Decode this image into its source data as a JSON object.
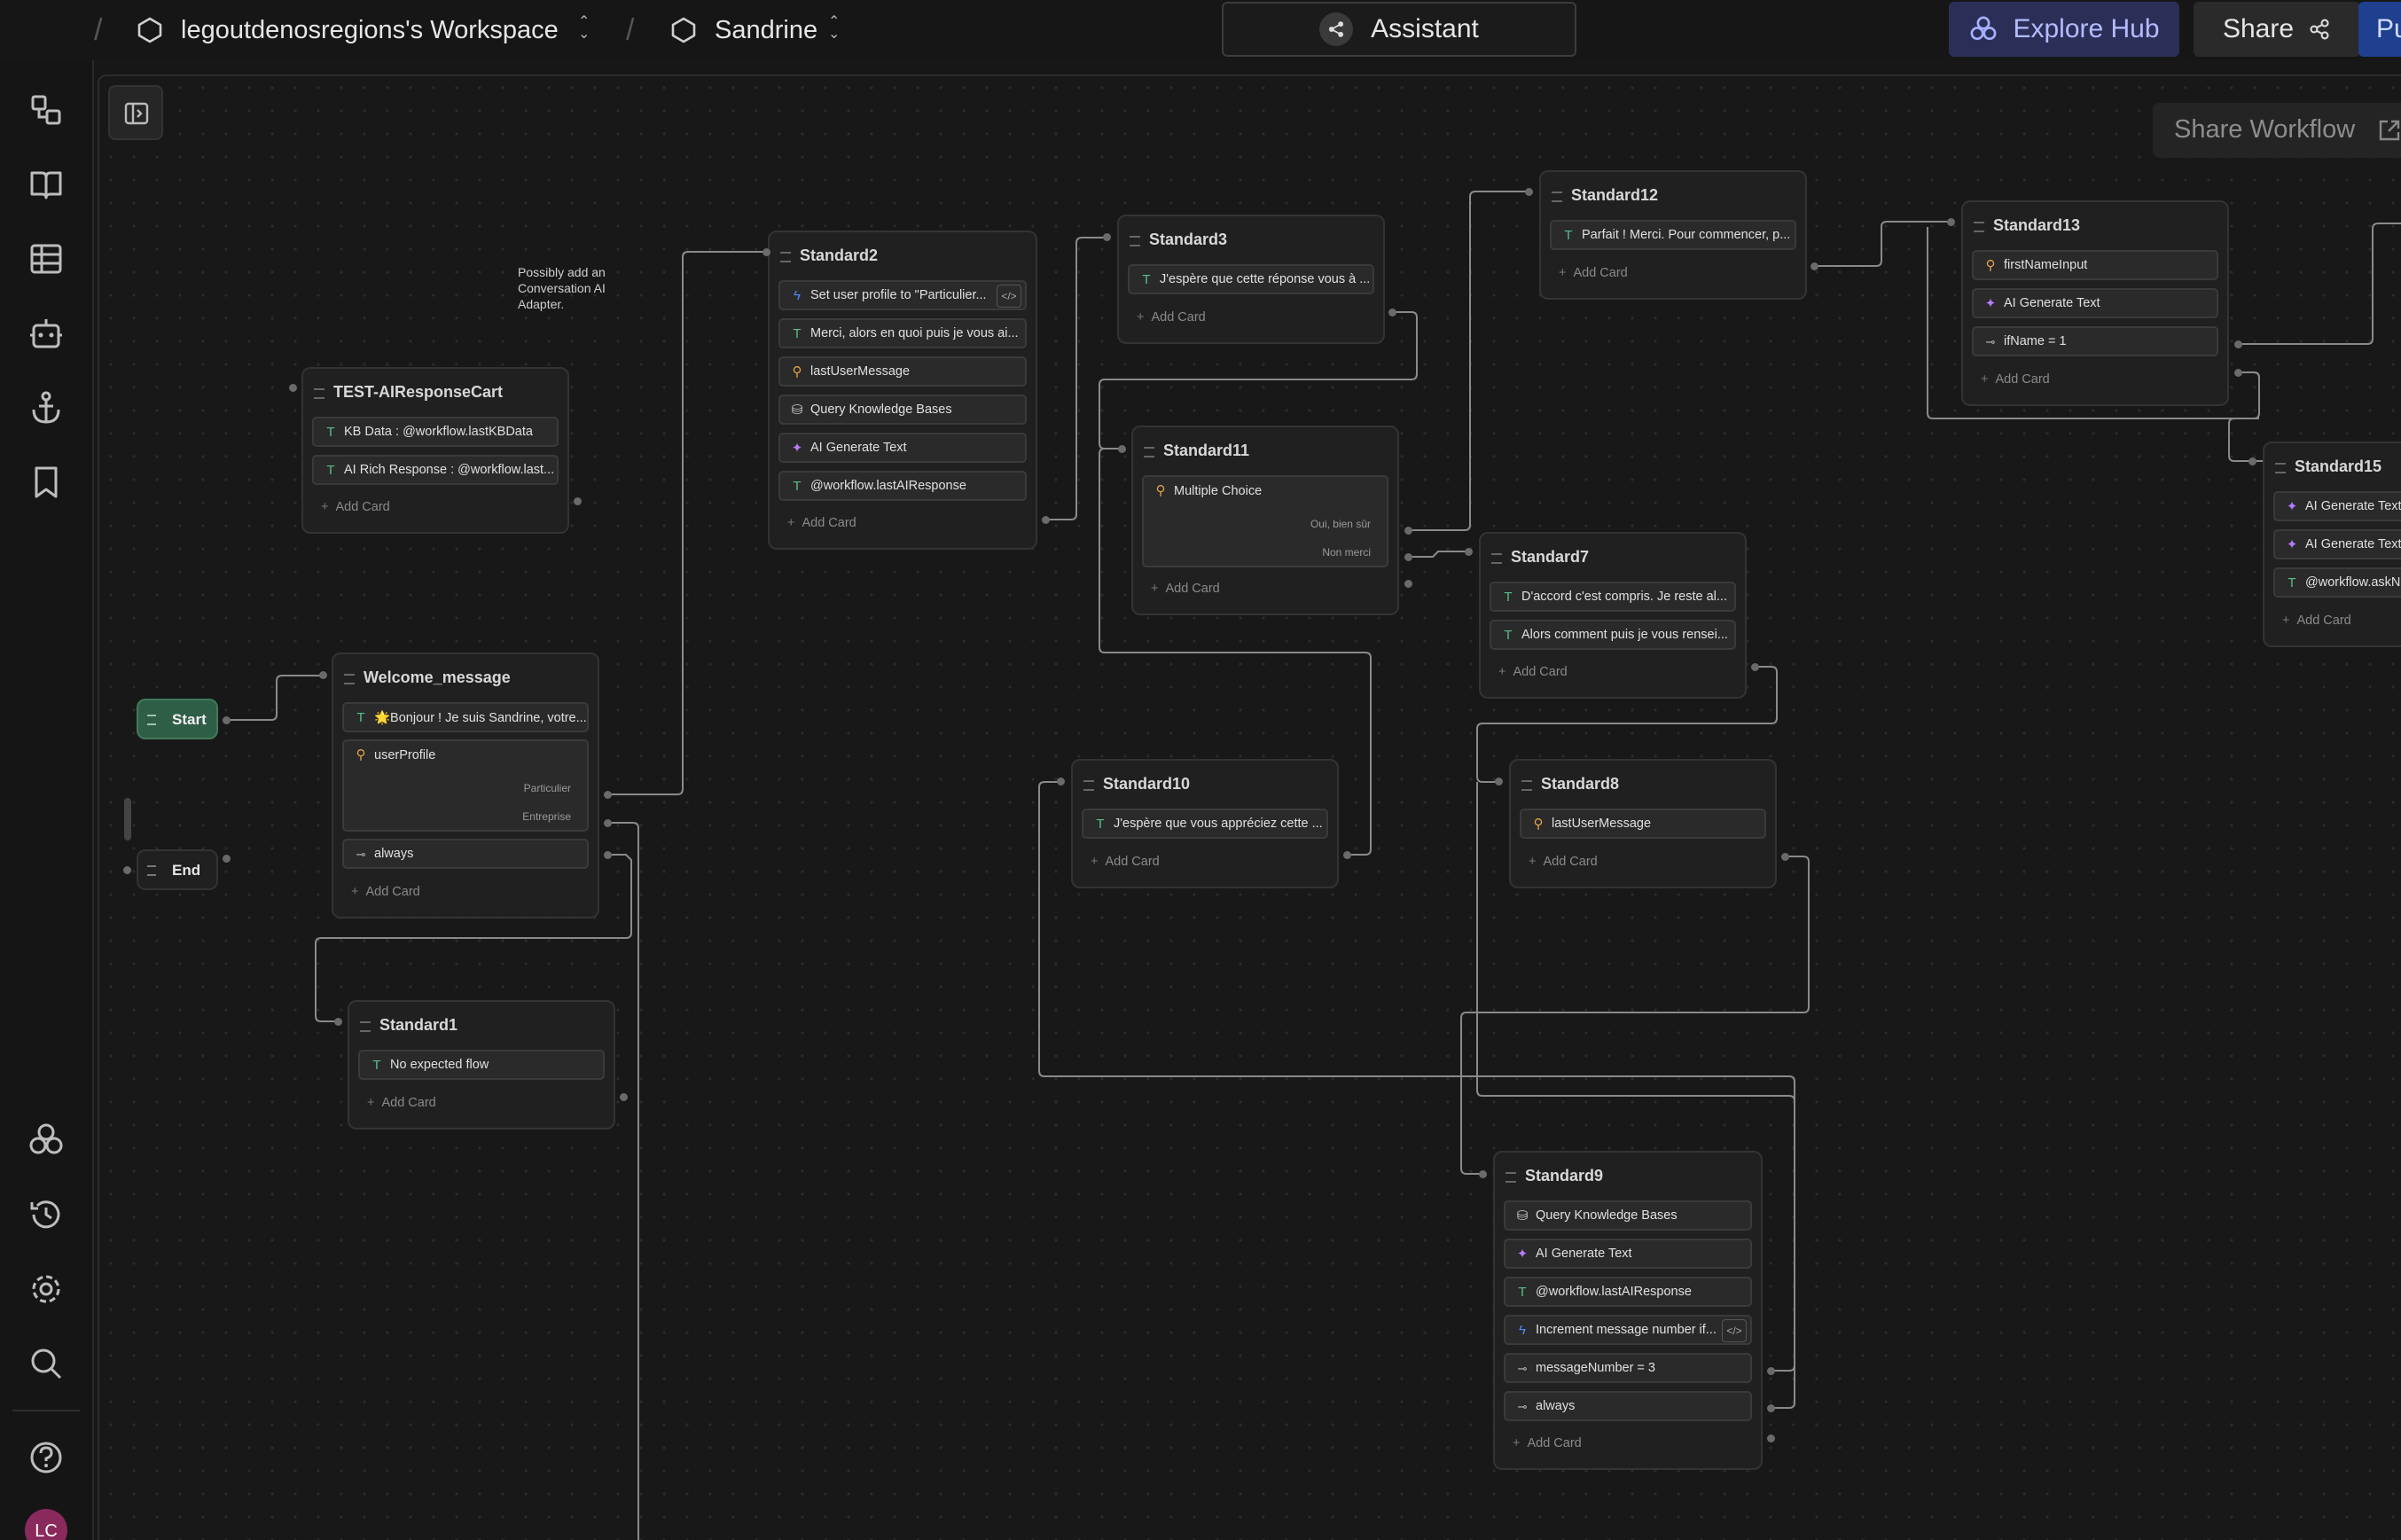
{
  "topbar": {
    "workspace": "legoutdenosregions's Workspace",
    "project": "Sandrine",
    "assistant_label": "Assistant",
    "explore_label": "Explore Hub",
    "share_label": "Share",
    "publish_label": "Pu"
  },
  "canvas": {
    "share_workflow_label": "Share Workflow",
    "note": "Possibly add an Conversation AI Adapter."
  },
  "sidebar": {
    "icons": [
      "flow-icon",
      "book-icon",
      "table-icon",
      "robot-icon",
      "anchor-icon",
      "bookmark-icon",
      "hub-icon",
      "history-icon",
      "settings-icon",
      "search-icon",
      "help-icon"
    ],
    "avatar": "LC"
  },
  "colors": {
    "text_icon": "#55c08a",
    "bolt_icon": "#4c8dff",
    "sparkle_icon": "#b57bff",
    "input_icon": "#e3a34a",
    "start": "#2f5e46"
  },
  "nodes": {
    "start": "Start",
    "end": "End",
    "welcome": {
      "title": "Welcome_message",
      "c1": "🌟Bonjour ! Je suis Sandrine, votre...",
      "c2": "userProfile",
      "o1": "Particulier",
      "o2": "Entreprise",
      "c3": "always",
      "add": "Add Card"
    },
    "test": {
      "title": "TEST-AIResponseCart",
      "c1": "KB Data : @workflow.lastKBData",
      "c2": "AI Rich Response : @workflow.last...",
      "add": "Add Card"
    },
    "std1": {
      "title": "Standard1",
      "c1": "No expected flow",
      "add": "Add Card"
    },
    "std2": {
      "title": "Standard2",
      "c1": "Set user profile to \"Particulier...",
      "c2": "Merci, alors en quoi puis je vous ai...",
      "c3": "lastUserMessage",
      "c4": "Query Knowledge Bases",
      "c5": "AI Generate Text",
      "c6": "@workflow.lastAIResponse",
      "add": "Add Card"
    },
    "std3": {
      "title": "Standard3",
      "c1": "J'espère que cette réponse vous à ...",
      "add": "Add Card"
    },
    "std11": {
      "title": "Standard11",
      "c1": "Multiple Choice",
      "o1": "Oui, bien sûr",
      "o2": "Non merci",
      "add": "Add Card"
    },
    "std12": {
      "title": "Standard12",
      "c1": "Parfait ! Merci. Pour commencer, p...",
      "add": "Add Card"
    },
    "std13": {
      "title": "Standard13",
      "c1": "firstNameInput",
      "c2": "AI Generate Text",
      "c3": "ifName = 1",
      "add": "Add Card"
    },
    "std15": {
      "title": "Standard15",
      "c1": "AI Generate Text",
      "c2": "AI Generate Text",
      "c3": "@workflow.askNa",
      "add": "Add Card"
    },
    "std7": {
      "title": "Standard7",
      "c1": "D'accord c'est compris. Je reste al...",
      "c2": "Alors comment puis je vous rensei...",
      "add": "Add Card"
    },
    "std10": {
      "title": "Standard10",
      "c1": "J'espère que vous appréciez cette ...",
      "add": "Add Card"
    },
    "std8": {
      "title": "Standard8",
      "c1": "lastUserMessage",
      "add": "Add Card"
    },
    "std9": {
      "title": "Standard9",
      "c1": "Query Knowledge Bases",
      "c2": "AI Generate Text",
      "c3": "@workflow.lastAIResponse",
      "c4": "Increment message number if...",
      "c5": "messageNumber = 3",
      "c6": "always",
      "add": "Add Card"
    }
  }
}
